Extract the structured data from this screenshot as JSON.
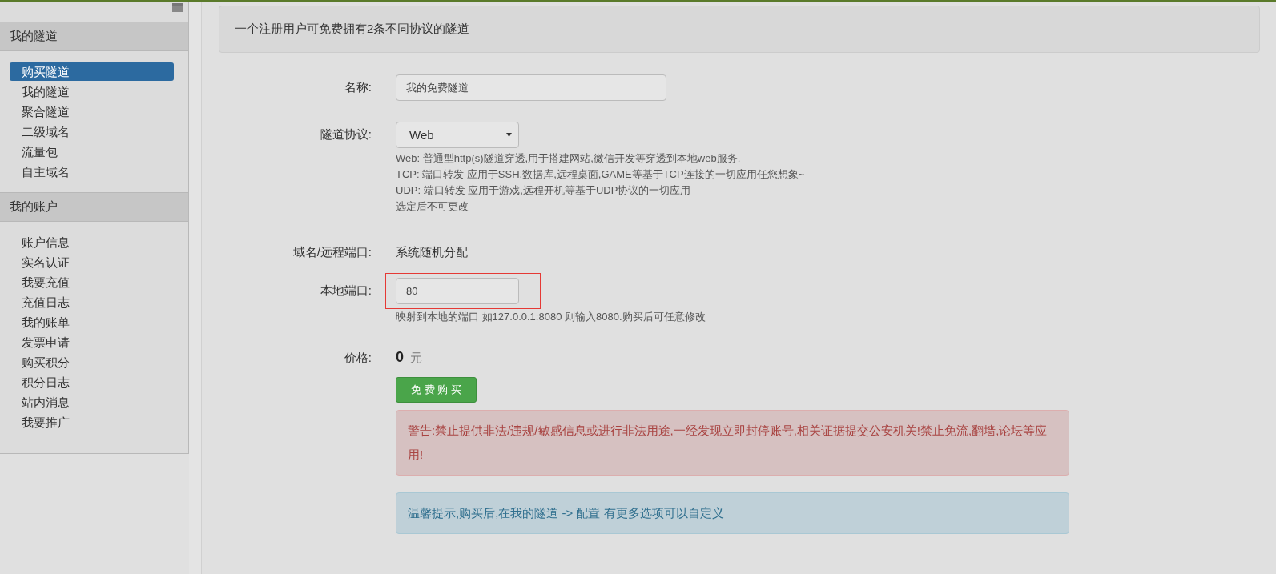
{
  "sidebar": {
    "sections": [
      {
        "title": "我的隧道",
        "items": [
          {
            "label": "购买隧道",
            "selected": true
          },
          {
            "label": "我的隧道",
            "selected": false
          },
          {
            "label": "聚合隧道",
            "selected": false
          },
          {
            "label": "二级域名",
            "selected": false
          },
          {
            "label": "流量包",
            "selected": false
          },
          {
            "label": "自主域名",
            "selected": false
          }
        ]
      },
      {
        "title": "我的账户",
        "items": [
          {
            "label": "账户信息",
            "selected": false
          },
          {
            "label": "实名认证",
            "selected": false
          },
          {
            "label": "我要充值",
            "selected": false
          },
          {
            "label": "充值日志",
            "selected": false
          },
          {
            "label": "我的账单",
            "selected": false
          },
          {
            "label": "发票申请",
            "selected": false
          },
          {
            "label": "购买积分",
            "selected": false
          },
          {
            "label": "积分日志",
            "selected": false
          },
          {
            "label": "站内消息",
            "selected": false
          },
          {
            "label": "我要推广",
            "selected": false
          }
        ]
      }
    ]
  },
  "notice": "一个注册用户可免费拥有2条不同协议的隧道",
  "form": {
    "rows": [
      {
        "kind": "text",
        "label": "名称:",
        "value": "我的免费隧道",
        "highlighted": false
      },
      {
        "kind": "select",
        "label": "隧道协议:",
        "value": "Web",
        "help": [
          "Web: 普通型http(s)隧道穿透,用于搭建网站,微信开发等穿透到本地web服务.",
          "TCP: 端口转发 应用于SSH,数据库,远程桌面,GAME等基于TCP连接的一切应用任您想象~",
          "UDP: 端口转发 应用于游戏,远程开机等基于UDP协议的一切应用",
          "选定后不可更改"
        ]
      },
      {
        "kind": "static",
        "label": "域名/远程端口:",
        "value": "系统随机分配"
      },
      {
        "kind": "text",
        "label": "本地端口:",
        "value": "80",
        "highlighted": true,
        "help": [
          "映射到本地的端口 如127.0.0.1:8080 则输入8080.购买后可任意修改"
        ]
      },
      {
        "kind": "price",
        "label": "价格:",
        "value": "0",
        "unit": "元"
      }
    ]
  },
  "button": "免 费 购 买",
  "warning": "警告:禁止提供非法/违规/敏感信息或进行非法用途,一经发现立即封停账号,相关证据提交公安机关!禁止免流,翻墙,论坛等应用!",
  "tip": "温馨提示,购买后,在我的隧道 -> 配置 有更多选项可以自定义"
}
